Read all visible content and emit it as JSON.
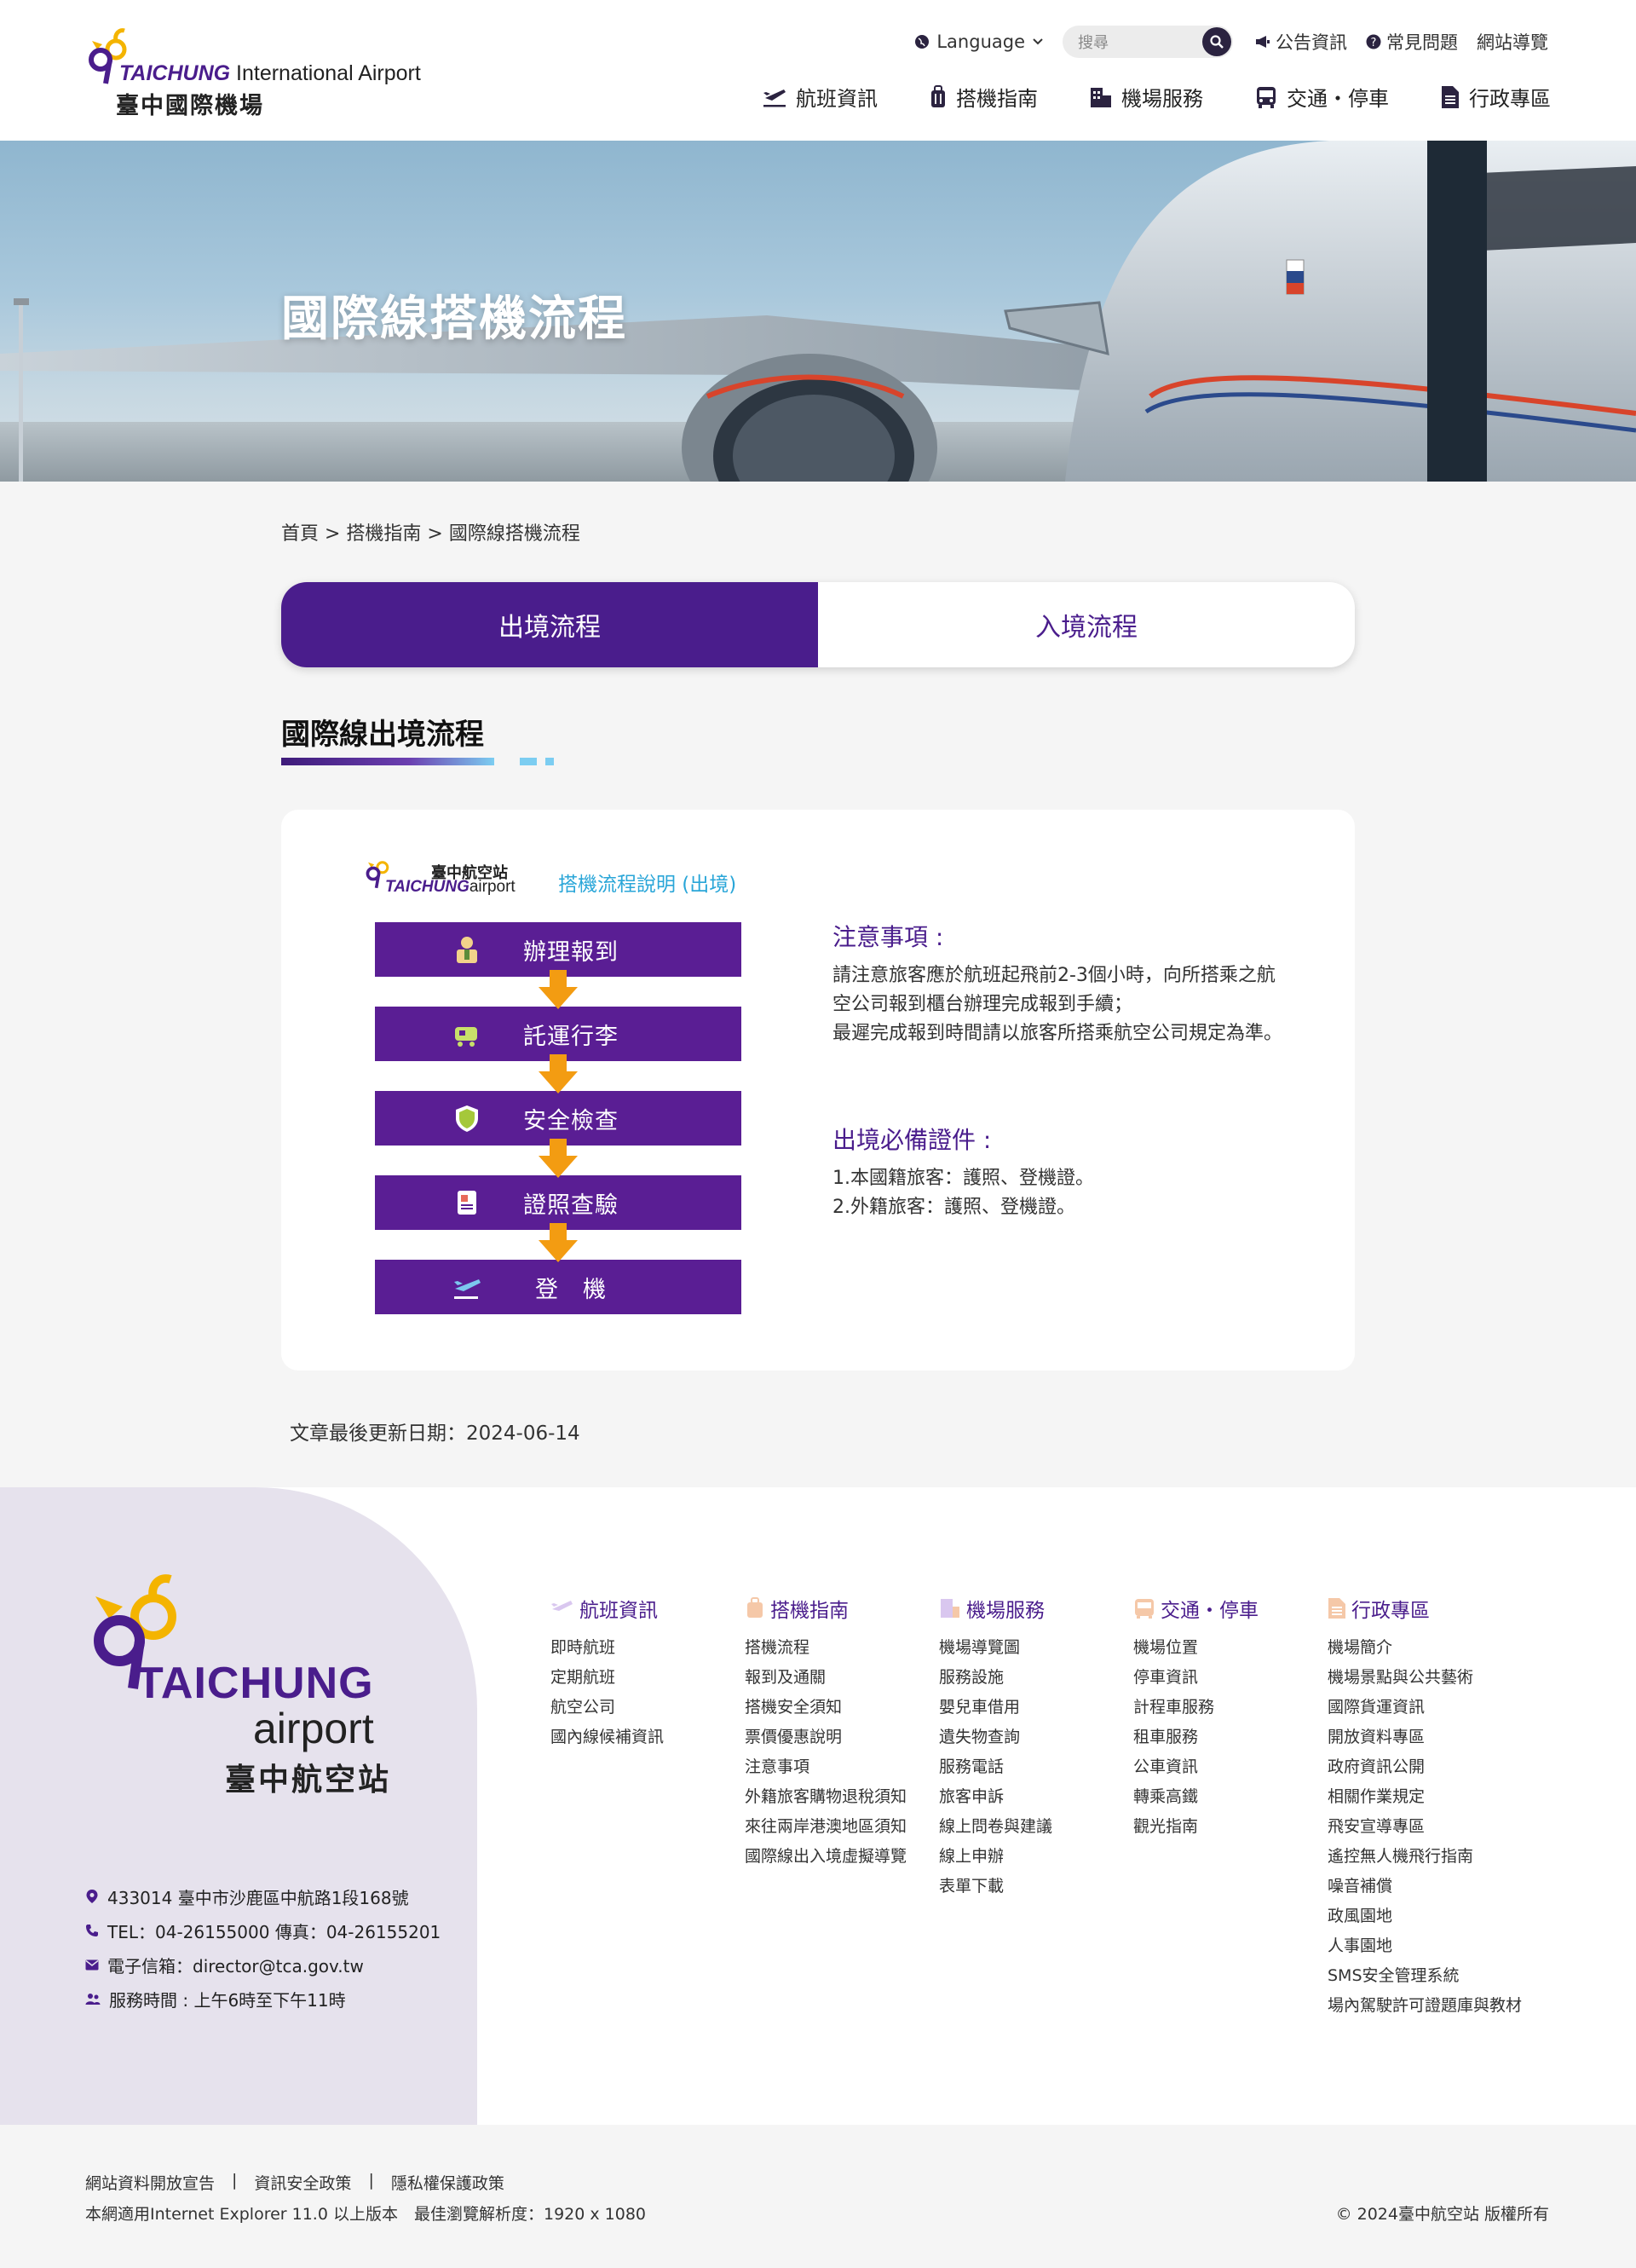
{
  "header": {
    "logo_en_brand": "TAICHUNG",
    "logo_en_rest": " International Airport",
    "logo_zh": "臺中國際機場",
    "language_label": "Language",
    "search_placeholder": "搜尋",
    "util_links": [
      "公告資訊",
      "常見問題",
      "網站導覽"
    ],
    "nav": [
      "航班資訊",
      "搭機指南",
      "機場服務",
      "交通・停車",
      "行政專區"
    ]
  },
  "hero": {
    "title": "國際線搭機流程"
  },
  "breadcrumb": "首頁 > 搭機指南 > 國際線搭機流程",
  "tabs": {
    "active": "出境流程",
    "inactive": "入境流程"
  },
  "section_title": "國際線出境流程",
  "flow": {
    "logo_zh": "臺中航空站",
    "logo_en_brand": "TAICHUNG",
    "logo_en_rest": "airport",
    "caption": "搭機流程說明 (出境)",
    "steps": [
      "辦理報到",
      "託運行李",
      "安全檢查",
      "證照查驗",
      "登　機"
    ]
  },
  "notes": {
    "h1": "注意事項 :",
    "p1": "請注意旅客應於航班起飛前2-3個小時，向所搭乘之航空公司報到櫃台辦理完成報到手續；",
    "p2": "最遲完成報到時間請以旅客所搭乘航空公司規定為準。",
    "h2": "出境必備證件 :",
    "p3": "1.本國籍旅客：護照、登機證。",
    "p4": "2.外籍旅客：護照、登機證。"
  },
  "updated": "文章最後更新日期：2024-06-14",
  "footer": {
    "brand_en": "TAICHUNG",
    "brand_air": "airport",
    "brand_zh": "臺中航空站",
    "address": "433014 臺中市沙鹿區中航路1段168號",
    "tel": "TEL：04-26155000   傳真：04-26155201",
    "email": "電子信箱：director@tca.gov.tw",
    "hours": "服務時間 : 上午6時至下午11時",
    "columns": [
      {
        "title": "航班資訊",
        "items": [
          "即時航班",
          "定期航班",
          "航空公司",
          "國內線候補資訊"
        ]
      },
      {
        "title": "搭機指南",
        "items": [
          "搭機流程",
          "報到及通關",
          "搭機安全須知",
          "票價優惠說明",
          "注意事項",
          "外籍旅客購物退稅須知",
          "來往兩岸港澳地區須知",
          "國際線出入境虛擬導覽"
        ]
      },
      {
        "title": "機場服務",
        "items": [
          "機場導覽圖",
          "服務設施",
          "嬰兒車借用",
          "遺失物查詢",
          "服務電話",
          "旅客申訴",
          "線上問卷與建議",
          "線上申辦",
          "表單下載"
        ]
      },
      {
        "title": "交通・停車",
        "items": [
          "機場位置",
          "停車資訊",
          "計程車服務",
          "租車服務",
          "公車資訊",
          "轉乘高鐵",
          "觀光指南"
        ]
      },
      {
        "title": "行政專區",
        "items": [
          "機場簡介",
          "機場景點與公共藝術",
          "國際貨運資訊",
          "開放資料專區",
          "政府資訊公開",
          "相關作業規定",
          "飛安宣導專區",
          "遙控無人機飛行指南",
          "噪音補償",
          "政風園地",
          "人事園地",
          "SMS安全管理系統",
          "場內駕駛許可證題庫與教材"
        ]
      }
    ],
    "bottom_links": [
      "網站資料開放宣告",
      "|",
      "資訊安全政策",
      "|",
      "隱私權保護政策"
    ],
    "bottom_note": "本網適用Internet Explorer 11.0 以上版本　最佳瀏覽解析度：1920 x 1080",
    "copyright": "© 2024臺中航空站 版權所有"
  },
  "colors": {
    "brand_purple": "#4a1d8c",
    "step_purple": "#5a1e94",
    "arrow_orange": "#f39c12",
    "accent_blue": "#2aa6d8"
  }
}
